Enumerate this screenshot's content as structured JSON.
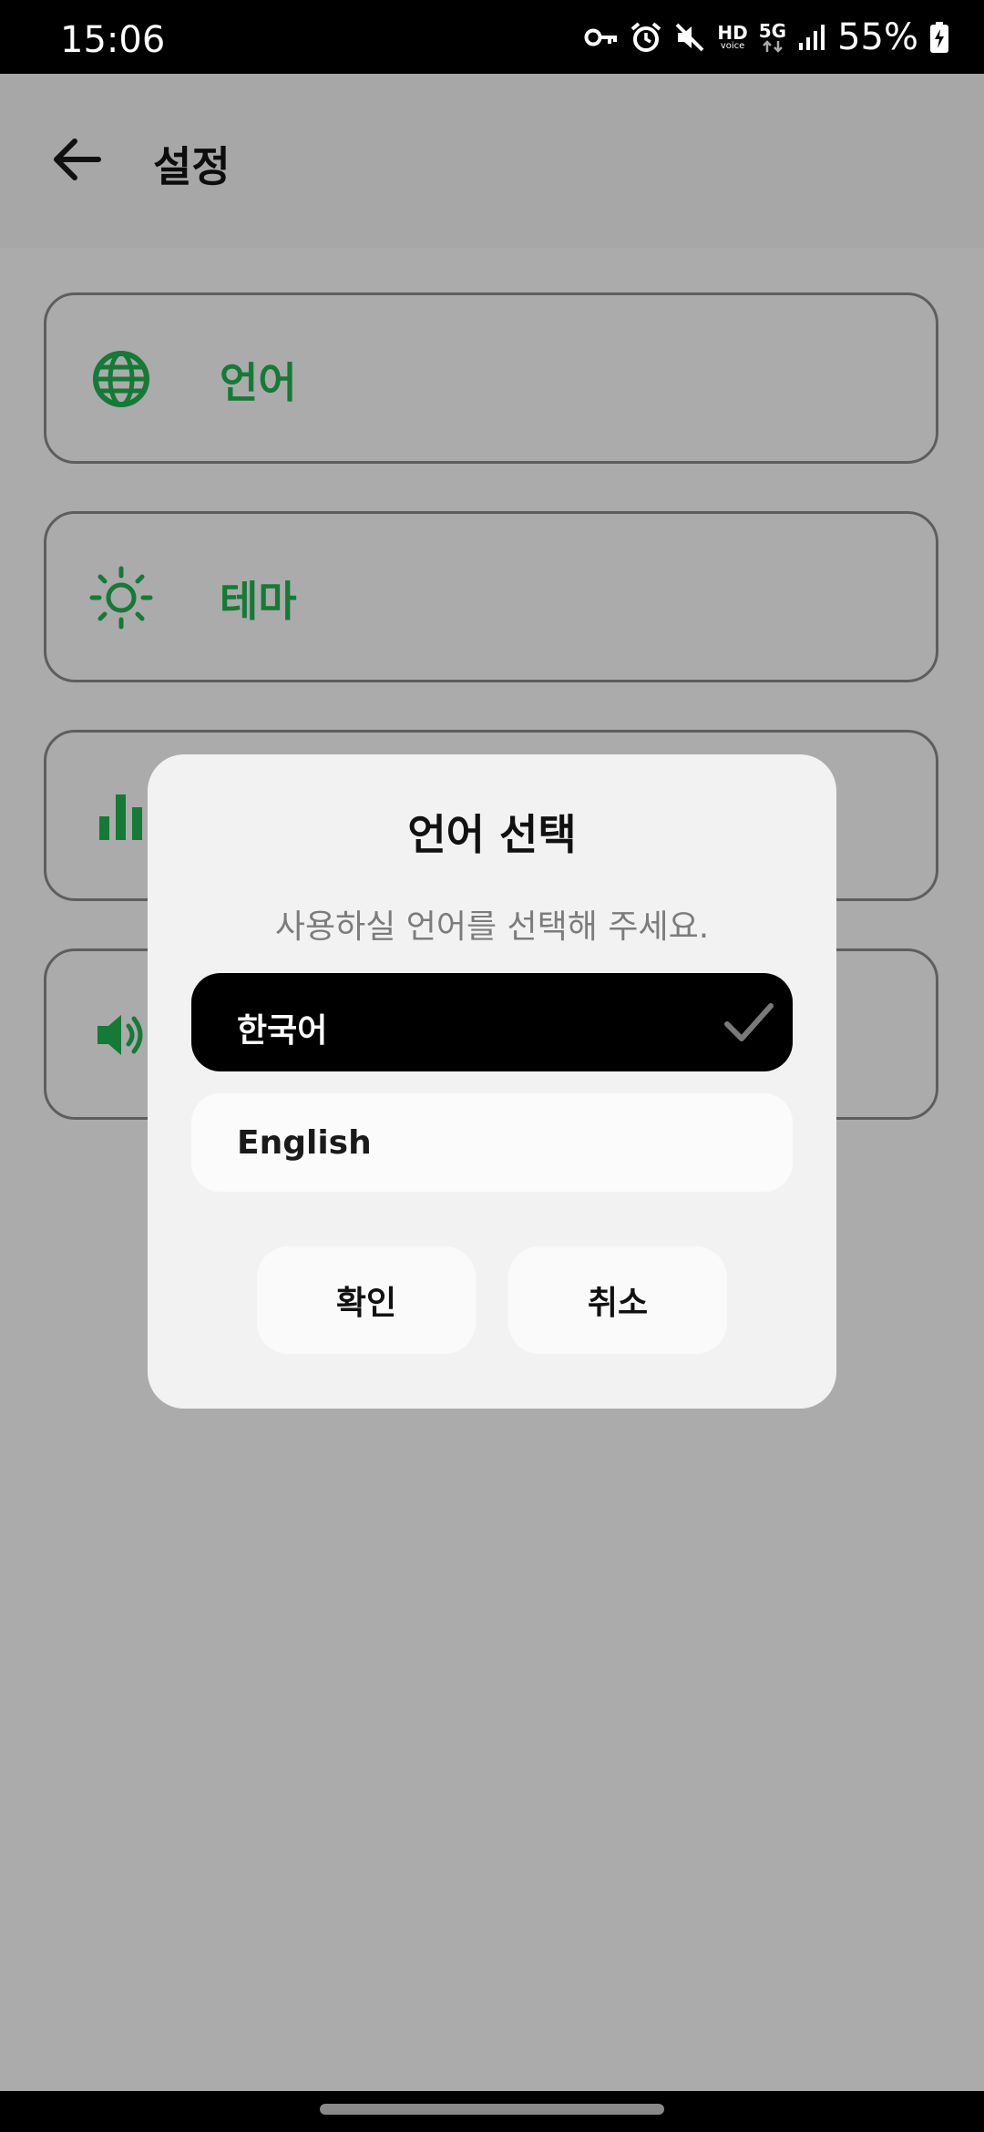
{
  "status_bar": {
    "time": "15:06",
    "hd_label": "HD",
    "voice_label": "voice",
    "network_label": "5G",
    "battery_percent": "55%",
    "icons": [
      "vpn-key-icon",
      "alarm-icon",
      "mute-icon",
      "hd-voice-icon",
      "5g-icon",
      "signal-icon",
      "battery-charging-icon"
    ]
  },
  "app_bar": {
    "title": "설정",
    "back_icon": "arrow-left-icon"
  },
  "settings": {
    "items": [
      {
        "label": "언어",
        "icon": "globe-icon"
      },
      {
        "label": "테마",
        "icon": "sun-icon"
      },
      {
        "label": "",
        "icon": "bar-chart-icon"
      },
      {
        "label": "",
        "icon": "speaker-icon"
      }
    ],
    "accent_color": "#157a36"
  },
  "dialog": {
    "title": "언어 선택",
    "message": "사용하실 언어를 선택해 주세요.",
    "options": [
      {
        "label": "한국어",
        "selected": true
      },
      {
        "label": "English",
        "selected": false
      }
    ],
    "confirm_label": "확인",
    "cancel_label": "취소"
  }
}
